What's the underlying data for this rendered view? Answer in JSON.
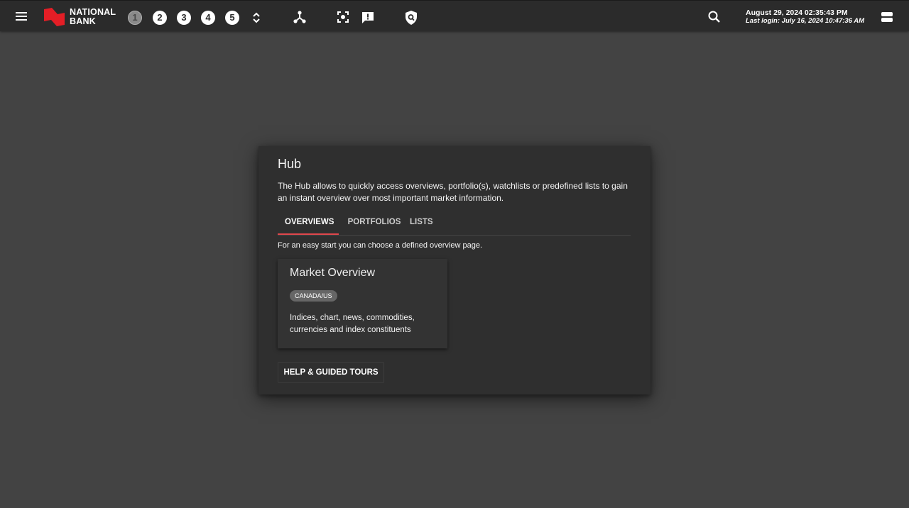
{
  "header": {
    "brand_line1": "NATIONAL",
    "brand_line2": "BANK",
    "workspaces": [
      "1",
      "2",
      "3",
      "4",
      "5"
    ],
    "active_workspace": "1",
    "datetime": "August 29, 2024 02:35:43 PM",
    "last_login": "Last login: July 16, 2024 10:47:36 AM"
  },
  "icons": {
    "menu": "menu-icon",
    "logo": "national-bank-logo",
    "workspace_toggle": "chevron-up-down-icon",
    "network": "network-icon",
    "focus": "focus-frame-icon",
    "alerts": "alert-message-icon",
    "security": "shield-search-icon",
    "search": "search-icon",
    "user": "account-icon"
  },
  "colors": {
    "accent": "#e0474c",
    "logo_red": "#e41e26",
    "background": "#434343",
    "topbar": "#2b2b2b",
    "panel": "#2f2f2f"
  },
  "hub": {
    "title": "Hub",
    "description": "The Hub allows to quickly access overviews, portfolio(s), watchlists or predefined lists to gain an instant overview over most important market information.",
    "tabs": [
      "OVERVIEWS",
      "PORTFOLIOS",
      "LISTS"
    ],
    "active_tab": "OVERVIEWS",
    "hint": "For an easy start you can choose a defined overview page.",
    "card": {
      "title": "Market Overview",
      "badge": "CANADA/US",
      "description": "Indices, chart, news, commodities, currencies and index constituents"
    },
    "help_button": "HELP & GUIDED TOURS"
  }
}
